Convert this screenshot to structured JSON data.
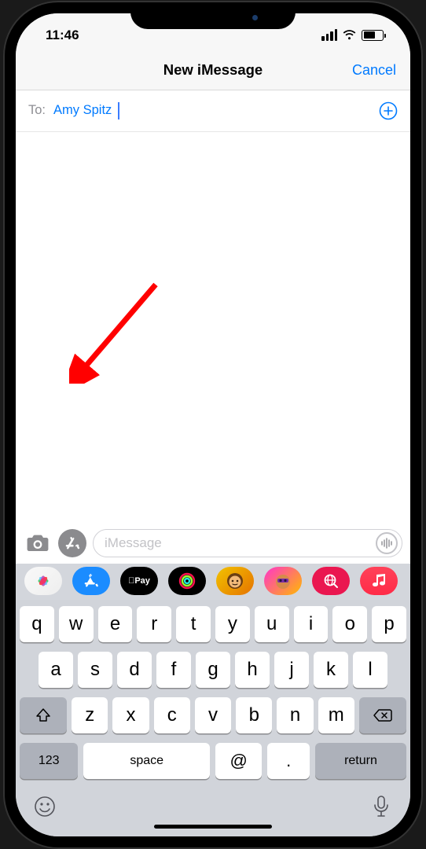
{
  "status": {
    "time": "11:46"
  },
  "header": {
    "title": "New iMessage",
    "cancel": "Cancel"
  },
  "compose": {
    "to_label": "To:",
    "recipient": "Amy Spitz",
    "input_placeholder": "iMessage"
  },
  "apps": {
    "pay_label": "Pay"
  },
  "keyboard": {
    "row1": [
      "q",
      "w",
      "e",
      "r",
      "t",
      "y",
      "u",
      "i",
      "o",
      "p"
    ],
    "row2": [
      "a",
      "s",
      "d",
      "f",
      "g",
      "h",
      "j",
      "k",
      "l"
    ],
    "row3": [
      "z",
      "x",
      "c",
      "v",
      "b",
      "n",
      "m"
    ],
    "numbers": "123",
    "space": "space",
    "at": "@",
    "dot": ".",
    "return": "return"
  }
}
